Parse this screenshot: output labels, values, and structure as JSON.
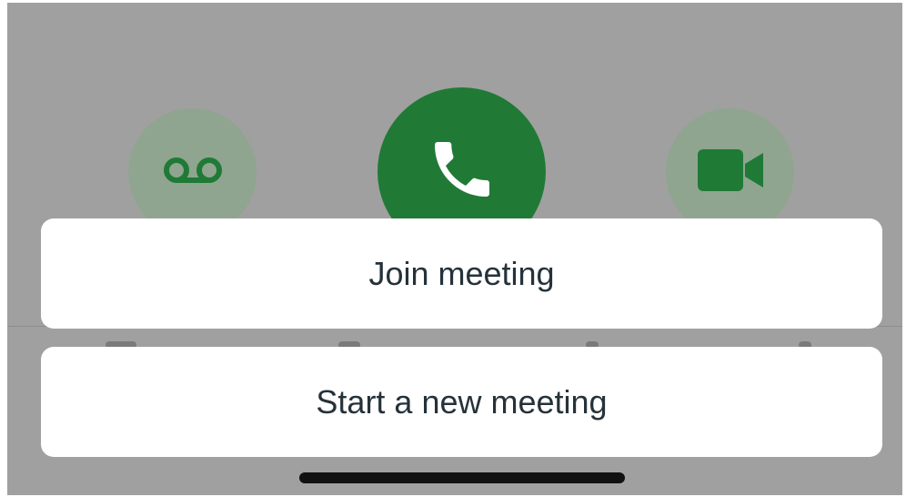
{
  "call_controls": {
    "voicemail_icon": "voicemail-icon",
    "call_icon": "phone-icon",
    "video_icon": "video-camera-icon"
  },
  "action_sheet": {
    "join_label": "Join meeting",
    "start_label": "Start a new meeting"
  },
  "colors": {
    "call_green": "#207a36",
    "dimmed_green": "#8fa58f",
    "icon_green": "#1f7a36",
    "overlay_gray": "#a0a0a0",
    "text": "#26323a"
  }
}
